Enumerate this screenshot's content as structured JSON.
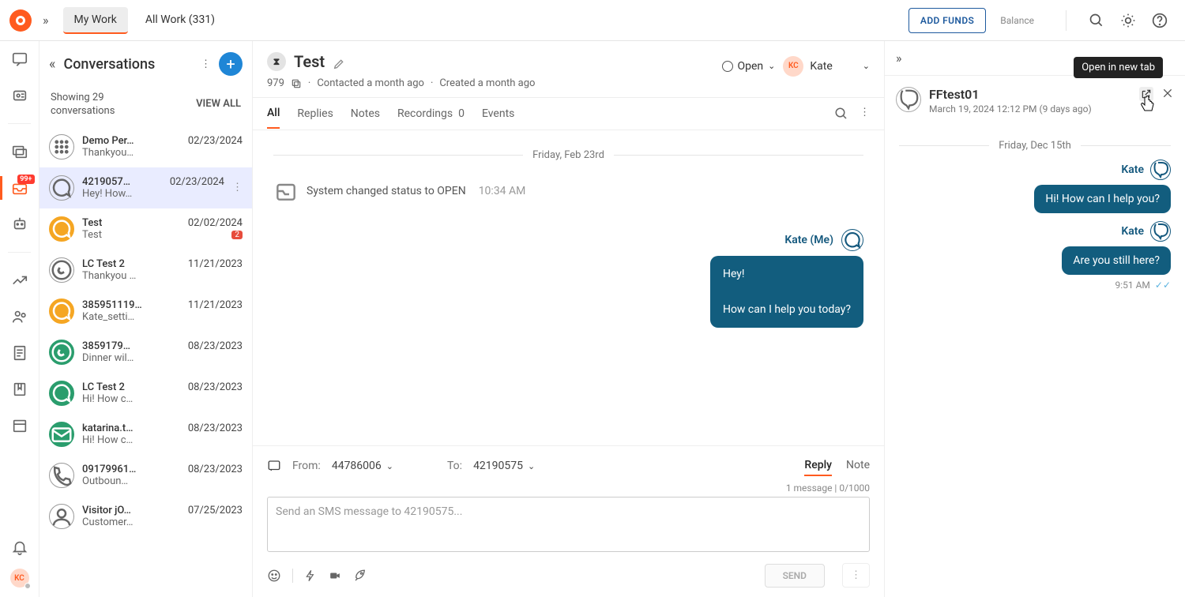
{
  "topbar": {
    "my_work": "My Work",
    "all_work": "All Work (331)",
    "add_funds": "ADD FUNDS",
    "balance": "Balance"
  },
  "rail": {
    "badge": "99+",
    "avatar": "KC"
  },
  "convs": {
    "title": "Conversations",
    "showing": "Showing 29\nconversations",
    "view_all": "VIEW ALL",
    "items": [
      {
        "name": "Demo Per…",
        "date": "02/23/2024",
        "preview": "Thankyou…",
        "iconText": "⊞"
      },
      {
        "name": "4219057…",
        "date": "02/23/2024",
        "preview": "Hey! How…"
      },
      {
        "name": "Test",
        "date": "02/02/2024",
        "preview": "Test",
        "unread": "2"
      },
      {
        "name": "LC Test 2",
        "date": "11/21/2023",
        "preview": "Thankyou …"
      },
      {
        "name": "385951119…",
        "date": "11/21/2023",
        "preview": "Kate_setti…"
      },
      {
        "name": "3859179…",
        "date": "08/23/2023",
        "preview": "Dinner wil…"
      },
      {
        "name": "LC Test 2",
        "date": "08/23/2023",
        "preview": "Hi! How c…"
      },
      {
        "name": "katarina.t…",
        "date": "08/23/2023",
        "preview": "Hi! How c…"
      },
      {
        "name": "09179961…",
        "date": "08/23/2023",
        "preview": "Outboun…"
      },
      {
        "name": "Visitor jO…",
        "date": "07/25/2023",
        "preview": "Customer…"
      }
    ]
  },
  "center": {
    "title": "Test",
    "id": "979",
    "meta1": "Contacted a month ago",
    "meta2": "Created a month ago",
    "status": "Open",
    "assignee_initials": "KC",
    "assignee": "Kate",
    "tabs": {
      "all": "All",
      "replies": "Replies",
      "notes": "Notes",
      "recordings": "Recordings",
      "rec_count": "0",
      "events": "Events"
    },
    "date_divider": "Friday, Feb 23rd",
    "sys_text": "System changed status to OPEN",
    "sys_time": "10:34 AM",
    "msg_sender": "Kate (Me)",
    "msg_l1": "Hey!",
    "msg_l2": "How can I help you today?",
    "from_label": "From:",
    "from": "44786006",
    "to_label": "To:",
    "to": "42190575",
    "reply": "Reply",
    "note": "Note",
    "counter": "1 message | 0/1000",
    "placeholder": "Send an SMS message to 42190575...",
    "send": "SEND"
  },
  "rpanel": {
    "tooltip": "Open in new tab",
    "name": "FFtest01",
    "ts": "March 19, 2024 12:12 PM (9 days ago)",
    "date_div": "Friday, Dec 15th",
    "sender": "Kate",
    "msg1": "Hi! How can I help you?",
    "msg2": "Are you still here?",
    "time": "9:51 AM"
  }
}
